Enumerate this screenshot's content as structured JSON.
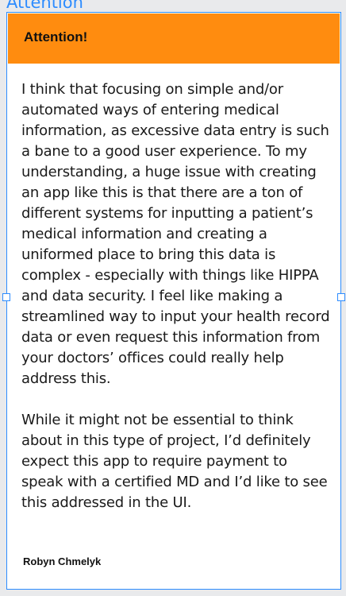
{
  "frame": {
    "label": "Attention"
  },
  "card": {
    "title": "Attention!",
    "paragraphs": [
      "I think that focusing on simple and/or automated ways of entering medical information, as excessive data entry is such a bane to a good user experience. To my understanding, a huge issue with creating an app like this is that there are a ton of different systems for inputting a patient’s medical information and creating a uniformed place to bring this data is complex - especially with things like HIPPA and data security. I feel like making a streamlined way to input your health record data or even request this information from your doctors’ offices could really help address this.",
      "While it might not be essential to think about in this type of project, I’d definitely expect this app to require payment to speak with a certified MD and I’d like to see this addressed in the UI."
    ],
    "author": "Robyn Chmelyk"
  },
  "colors": {
    "selection": "#2d8cff",
    "header": "#ff8c0f",
    "background": "#e9eaec"
  }
}
